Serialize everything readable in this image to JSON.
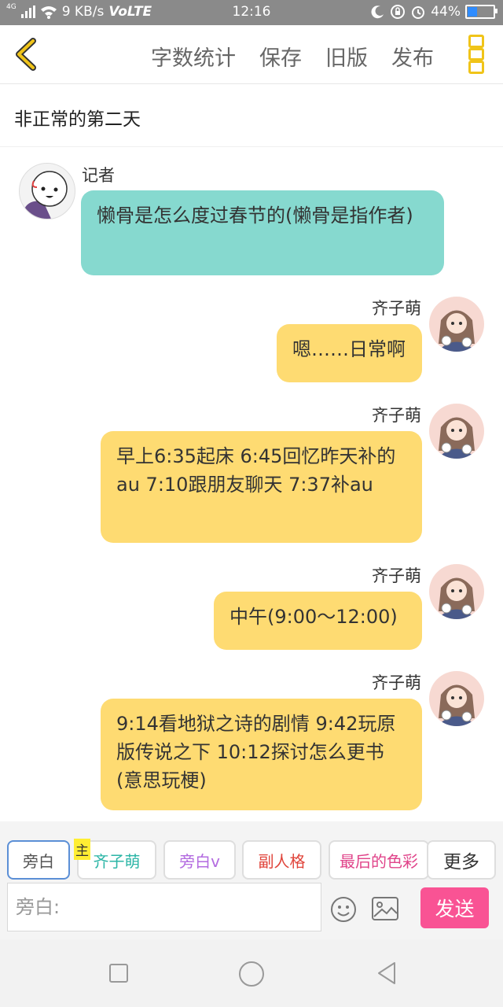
{
  "status": {
    "network_type": "4G",
    "speed": "9 KB/s",
    "volte": "VoLTE",
    "time": "12:16",
    "battery": "44%",
    "battery_level": 0.44
  },
  "topbar": {
    "links": [
      "字数统计",
      "保存",
      "旧版",
      "发布"
    ],
    "accent_color": "#f0c419"
  },
  "story_title": "非正常的第二天",
  "messages": [
    {
      "side": "left",
      "name": "记者",
      "text": "懒骨是怎么度过春节的(懒骨是指作者)",
      "color": "#86d9cf"
    },
    {
      "side": "right",
      "name": "齐子萌",
      "text": "嗯……日常啊",
      "color": "#fedb72"
    },
    {
      "side": "right",
      "name": "齐子萌",
      "text": "早上6:35起床 6:45回忆昨天补的au 7:10跟朋友聊天 7:37补au",
      "color": "#fedb72"
    },
    {
      "side": "right",
      "name": "齐子萌",
      "text": "中午(9:00～12:00)",
      "color": "#fedb72"
    },
    {
      "side": "right",
      "name": "齐子萌",
      "text": "9:14看地狱之诗的剧情 9:42玩原版传说之下 10:12探讨怎么更书(意思玩梗)",
      "color": "#fedb72"
    }
  ],
  "role_tabs": [
    {
      "label": "旁白",
      "color": "#555555"
    },
    {
      "label": "齐子萌",
      "color": "#2bb5a6"
    },
    {
      "label": "旁白v",
      "color": "#b36be0"
    },
    {
      "label": "副人格",
      "color": "#e0443a"
    },
    {
      "label": "最后的色彩",
      "color": "#e0448a"
    },
    {
      "label": "更多",
      "color": "#333333"
    }
  ],
  "main_badge": "主",
  "input": {
    "placeholder": "旁白:"
  },
  "send_label": "发送",
  "send_color": "#f95394"
}
